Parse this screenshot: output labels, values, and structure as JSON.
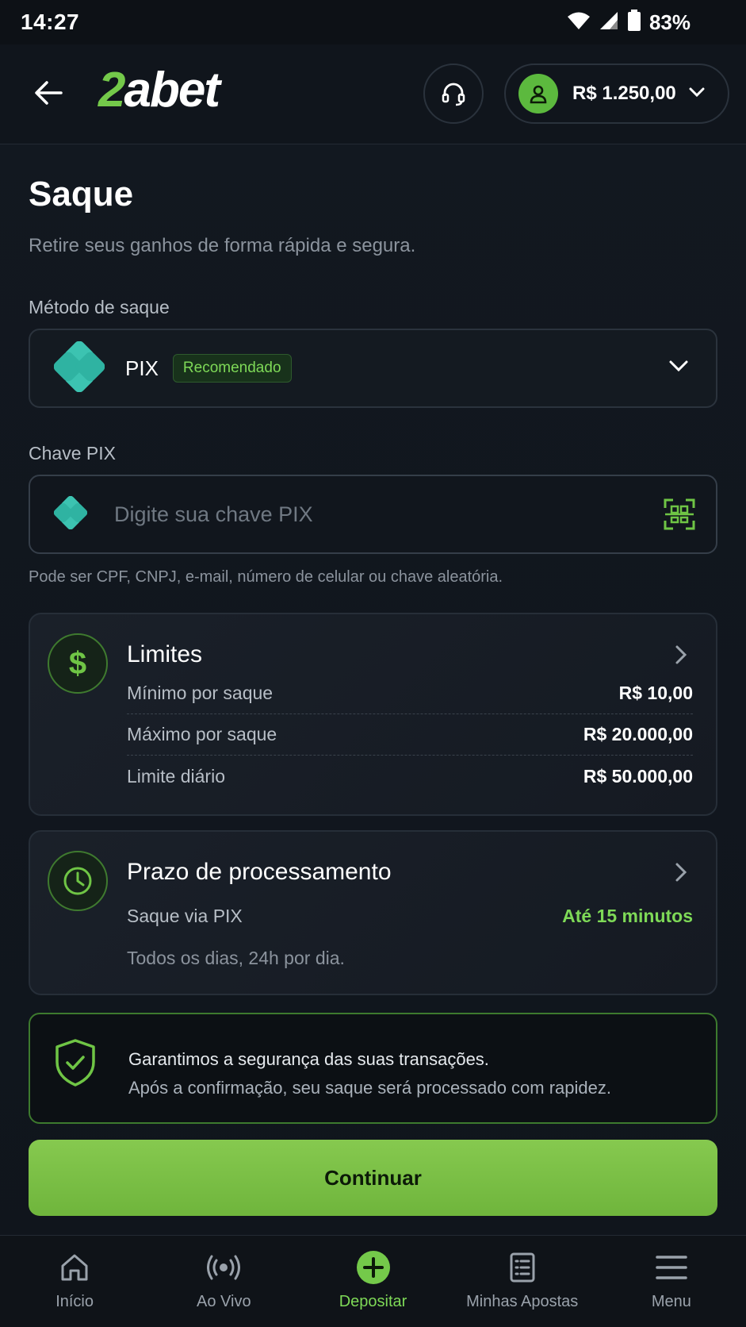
{
  "status": {
    "time": "14:27",
    "battery": "83%"
  },
  "header": {
    "logo_num": "2",
    "logo_text": "abet",
    "balance": "R$ 1.250,00"
  },
  "page": {
    "title": "Saque",
    "subtitle": "Retire seus ganhos de forma rápida e segura."
  },
  "method": {
    "label": "Método de saque",
    "selected": "PIX",
    "badge": "Recomendado"
  },
  "pix_key": {
    "label": "Chave PIX",
    "placeholder": "Digite sua chave PIX",
    "value": "",
    "hint": "Pode ser CPF, CNPJ, e-mail, número de celular ou chave aleatória."
  },
  "limits": {
    "title": "Limites",
    "rows": [
      {
        "label": "Mínimo por saque",
        "value": "R$ 10,00"
      },
      {
        "label": "Máximo por saque",
        "value": "R$ 20.000,00"
      },
      {
        "label": "Limite diário",
        "value": "R$ 50.000,00"
      }
    ]
  },
  "processing": {
    "title": "Prazo de processamento",
    "method_label": "Saque via PIX",
    "time_value": "Até 15 minutos",
    "note": "Todos os dias, 24h por dia."
  },
  "security": {
    "line1": "Garantimos a segurança das suas transações.",
    "line2": "Após a confirmação, seu saque será processado com rapidez."
  },
  "continue_label": "Continuar",
  "nav": [
    {
      "label": "Início",
      "icon": "home-icon"
    },
    {
      "label": "Ao Vivo",
      "icon": "live-icon"
    },
    {
      "label": "Depositar",
      "icon": "plus-icon",
      "active": true
    },
    {
      "label": "Minhas Apostas",
      "icon": "bets-icon"
    },
    {
      "label": "Menu",
      "icon": "menu-icon"
    }
  ],
  "colors": {
    "accent": "#7ed957",
    "background": "#11161d",
    "pix": "#32bcad"
  }
}
